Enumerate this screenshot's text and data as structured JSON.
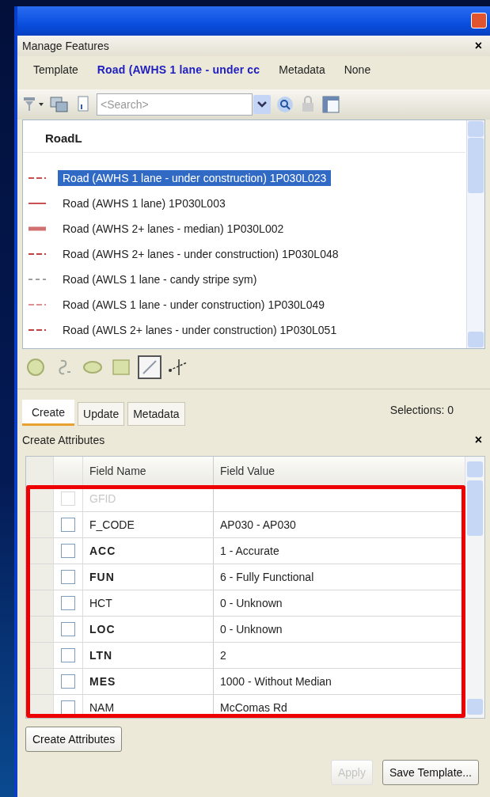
{
  "panel": {
    "title": "Manage Features",
    "close": "×"
  },
  "template_bar": [
    {
      "kind": "label",
      "text": "Template"
    },
    {
      "kind": "link",
      "text": "Road (AWHS 1 lane - under cc"
    },
    {
      "kind": "label",
      "text": "Metadata"
    },
    {
      "kind": "label",
      "text": "None"
    }
  ],
  "search": {
    "placeholder": "<Search>"
  },
  "feature_list": {
    "header": "RoadL",
    "items": [
      {
        "label": "Road (AWHS 1 lane - under construction) 1P030L023",
        "kind": "dashed",
        "color": "#c85050",
        "selected": true
      },
      {
        "label": "Road (AWHS 1 lane) 1P030L003",
        "kind": "solid",
        "color": "#c85050",
        "selected": false
      },
      {
        "label": "Road (AWHS 2+ lanes - median) 1P030L002",
        "kind": "thick",
        "color": "#d07070",
        "selected": false
      },
      {
        "label": "Road (AWHS 2+ lanes - under construction) 1P030L048",
        "kind": "dashed",
        "color": "#c04040",
        "selected": false
      },
      {
        "label": "Road (AWLS 1 lane - candy stripe sym)",
        "kind": "dotted",
        "color": "#a0a0a0",
        "selected": false
      },
      {
        "label": "Road (AWLS 1 lane - under construction) 1P030L049",
        "kind": "dashed",
        "color": "#e09090",
        "selected": false
      },
      {
        "label": "Road (AWLS 2+ lanes - under construction) 1P030L051",
        "kind": "dashed",
        "color": "#c04040",
        "selected": false
      }
    ]
  },
  "tools": [
    {
      "kind": "circle",
      "selected": false
    },
    {
      "kind": "freehand",
      "selected": false
    },
    {
      "kind": "ellipse",
      "selected": false
    },
    {
      "kind": "rectangle",
      "selected": false
    },
    {
      "kind": "line",
      "selected": true
    },
    {
      "kind": "midpoint",
      "selected": false
    }
  ],
  "tabs": [
    {
      "label": "Create",
      "selected": true
    },
    {
      "label": "Update",
      "selected": false
    },
    {
      "label": "Metadata",
      "selected": false
    }
  ],
  "selections": "Selections: 0",
  "attributes": {
    "title": "Create Attributes",
    "close": "×",
    "columns": [
      "Field Name",
      "Field Value"
    ],
    "rows": [
      {
        "name": "GFID",
        "value": "",
        "bold": false,
        "disabled": true,
        "checked": false
      },
      {
        "name": "F_CODE",
        "value": "AP030 - AP030",
        "bold": false,
        "disabled": false,
        "checked": false
      },
      {
        "name": "ACC",
        "value": "1 - Accurate",
        "bold": true,
        "disabled": false,
        "checked": false
      },
      {
        "name": "FUN",
        "value": "6 - Fully Functional",
        "bold": true,
        "disabled": false,
        "checked": false
      },
      {
        "name": "HCT",
        "value": "0 - Unknown",
        "bold": false,
        "disabled": false,
        "checked": false
      },
      {
        "name": "LOC",
        "value": "0 - Unknown",
        "bold": true,
        "disabled": false,
        "checked": false
      },
      {
        "name": "LTN",
        "value": "2",
        "bold": true,
        "disabled": false,
        "checked": false
      },
      {
        "name": "MES",
        "value": "1000 - Without Median",
        "bold": true,
        "disabled": false,
        "checked": false
      },
      {
        "name": "NAM",
        "value": "McComas Rd",
        "bold": false,
        "disabled": false,
        "checked": false
      }
    ]
  },
  "buttons": [
    {
      "label": "Create Attributes",
      "disabled": false
    },
    {
      "label": "Apply",
      "disabled": true
    },
    {
      "label": "Save Template...",
      "disabled": false
    }
  ]
}
